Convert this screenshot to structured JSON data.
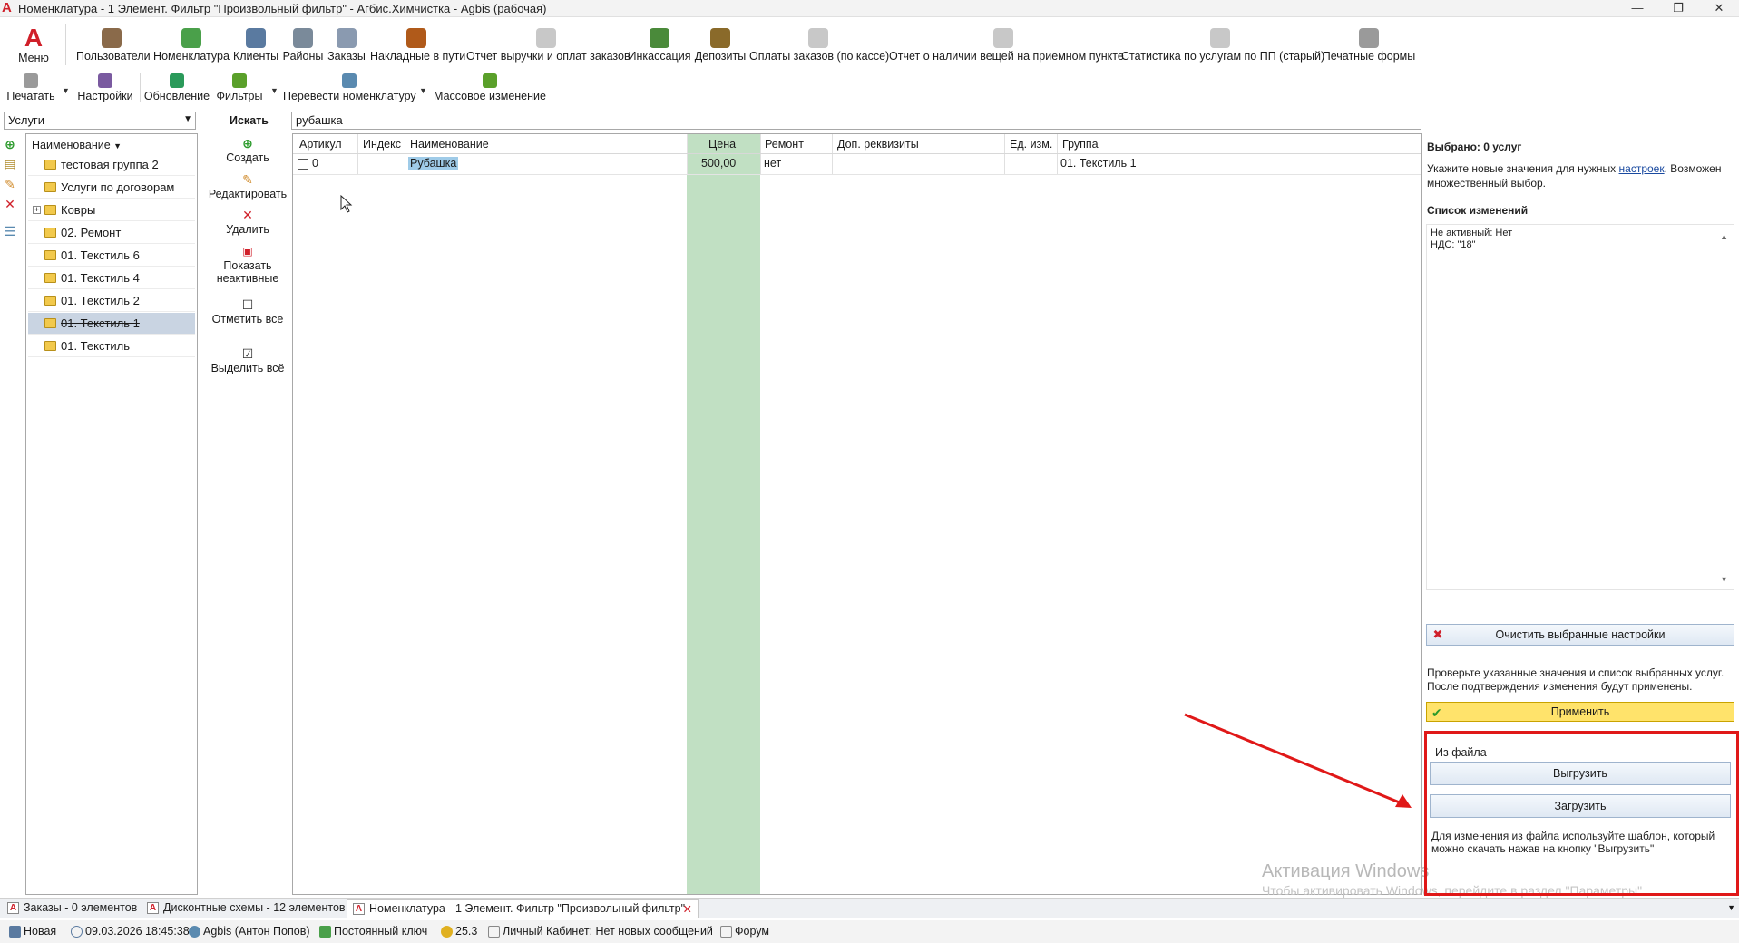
{
  "window": {
    "title": "Номенклатура - 1 Элемент. Фильтр \"Произвольный фильтр\" - Агбис.Химчистка - Agbis (рабочая)",
    "minimize": "—",
    "maximize": "❐",
    "close": "✕"
  },
  "ribbon": {
    "menu_label": "Меню",
    "items": [
      {
        "label": "Пользователи",
        "icon": "users-icon",
        "color": "#8a6a4a"
      },
      {
        "label": "Номенклатура",
        "icon": "basket-icon",
        "color": "#4aa04a"
      },
      {
        "label": "Клиенты",
        "icon": "client-icon",
        "color": "#5a7aa0"
      },
      {
        "label": "Районы",
        "icon": "district-icon",
        "color": "#7a8a9a"
      },
      {
        "label": "Заказы",
        "icon": "orders-icon",
        "color": "#8a9ab0"
      },
      {
        "label": "Накладные в пути",
        "icon": "truck-icon",
        "color": "#b05a1a"
      },
      {
        "label": "Отчет выручки и оплат заказов",
        "icon": "report-icon",
        "color": "#c8c8c8"
      },
      {
        "label": "Инкассация",
        "icon": "money-icon",
        "color": "#4a8a3a"
      },
      {
        "label": "Депозиты",
        "icon": "deposit-icon",
        "color": "#8a6a2a"
      },
      {
        "label": "Оплаты заказов (по кассе)",
        "icon": "report-icon",
        "color": "#c8c8c8"
      },
      {
        "label": "Отчет о наличии вещей на приемном пункте",
        "icon": "report-icon",
        "color": "#c8c8c8"
      },
      {
        "label": "Статистика по услугам по ПП (старый)",
        "icon": "report-icon",
        "color": "#c8c8c8"
      },
      {
        "label": "Печатные формы",
        "icon": "printer-icon",
        "color": "#9a9a9a"
      }
    ],
    "row2": [
      {
        "label": "Печатать",
        "icon": "print-icon",
        "color": "#9a9a9a"
      },
      {
        "label": "Настройки",
        "icon": "settings-icon",
        "color": "#7a5aa0"
      },
      {
        "label": "Обновление",
        "icon": "refresh-icon",
        "color": "#2a9a5a"
      },
      {
        "label": "Фильтры",
        "icon": "filter-icon",
        "color": "#5aa02a"
      },
      {
        "label": "Перевести номенклатуру",
        "icon": "transfer-icon",
        "color": "#5a8ab0"
      },
      {
        "label": "Массовое изменение",
        "icon": "pencil-icon",
        "color": "#5aa02a"
      }
    ]
  },
  "filter": {
    "category_value": "Услуги",
    "search_label": "Искать",
    "search_value": "рубашка"
  },
  "tree": {
    "header": "Наименование",
    "items": [
      {
        "label": "тестовая группа 2"
      },
      {
        "label": "Услуги по договорам"
      },
      {
        "label": "Ковры"
      },
      {
        "label": "02. Ремонт"
      },
      {
        "label": "01. Текстиль 6"
      },
      {
        "label": "01. Текстиль 4"
      },
      {
        "label": "01. Текстиль 2"
      },
      {
        "label": "01. Текстиль 1"
      },
      {
        "label": "01. Текстиль"
      }
    ]
  },
  "actions": {
    "create": "Создать",
    "edit": "Редактировать",
    "delete": "Удалить",
    "show_inactive_1": "Показать",
    "show_inactive_2": "неактивные",
    "check_all": "Отметить все",
    "select_all": "Выделить всё"
  },
  "grid": {
    "headers": [
      "Артикул",
      "Индекс",
      "Наименование",
      "Цена",
      "Ремонт",
      "Доп. реквизиты",
      "Ед. изм.",
      "Группа"
    ],
    "row": {
      "article": "0",
      "index": "",
      "name": "Рубашка",
      "price": "500,00",
      "repair": "нет",
      "extra": "",
      "unit": "",
      "group": "01. Текстиль 1"
    }
  },
  "panel": {
    "selected": "Выбрано: 0 услуг",
    "hint_prefix": "Укажите новые значения для нужных ",
    "hint_link": "настроек",
    "hint_suffix": ". Возможен",
    "hint_line2": "множественный выбор.",
    "changes_title": "Список изменений",
    "changes": [
      "Не активный: Нет",
      "НДС: \"18\""
    ],
    "clear_button": "Очистить выбранные настройки",
    "verify_line1": "Проверьте указанные значения и список выбранных услуг.",
    "verify_line2": "После подтверждения изменения будут применены.",
    "apply_button": "Применить",
    "file_group": "Из файла",
    "export_button": "Выгрузить",
    "import_button": "Загрузить",
    "file_hint_line1": "Для изменения из файла используйте шаблон, который",
    "file_hint_line2": "можно скачать нажав на кнопку \"Выгрузить\""
  },
  "tabs": [
    {
      "label": "Заказы - 0 элементов"
    },
    {
      "label": "Дисконтные схемы - 12 элементов"
    },
    {
      "label": "Номенклатура - 1 Элемент. Фильтр \"Произвольный фильтр\""
    }
  ],
  "status": {
    "mode": "Новая",
    "datetime": "09.03.2026 18:45:38",
    "user": "Agbis (Антон Попов)",
    "key": "Постоянный ключ",
    "version": "25.3",
    "cabinet": "Личный Кабинет: Нет новых сообщений",
    "forum": "Форум"
  },
  "watermark": {
    "line1": "Активация Windows",
    "line2": "Чтобы активировать Windows, перейдите в раздел \"Параметры\"."
  },
  "colors": {
    "accent_red": "#e01818",
    "price_column": "#c1e0c3",
    "selection": "#9fcbe8",
    "apply": "#ffe36b"
  }
}
